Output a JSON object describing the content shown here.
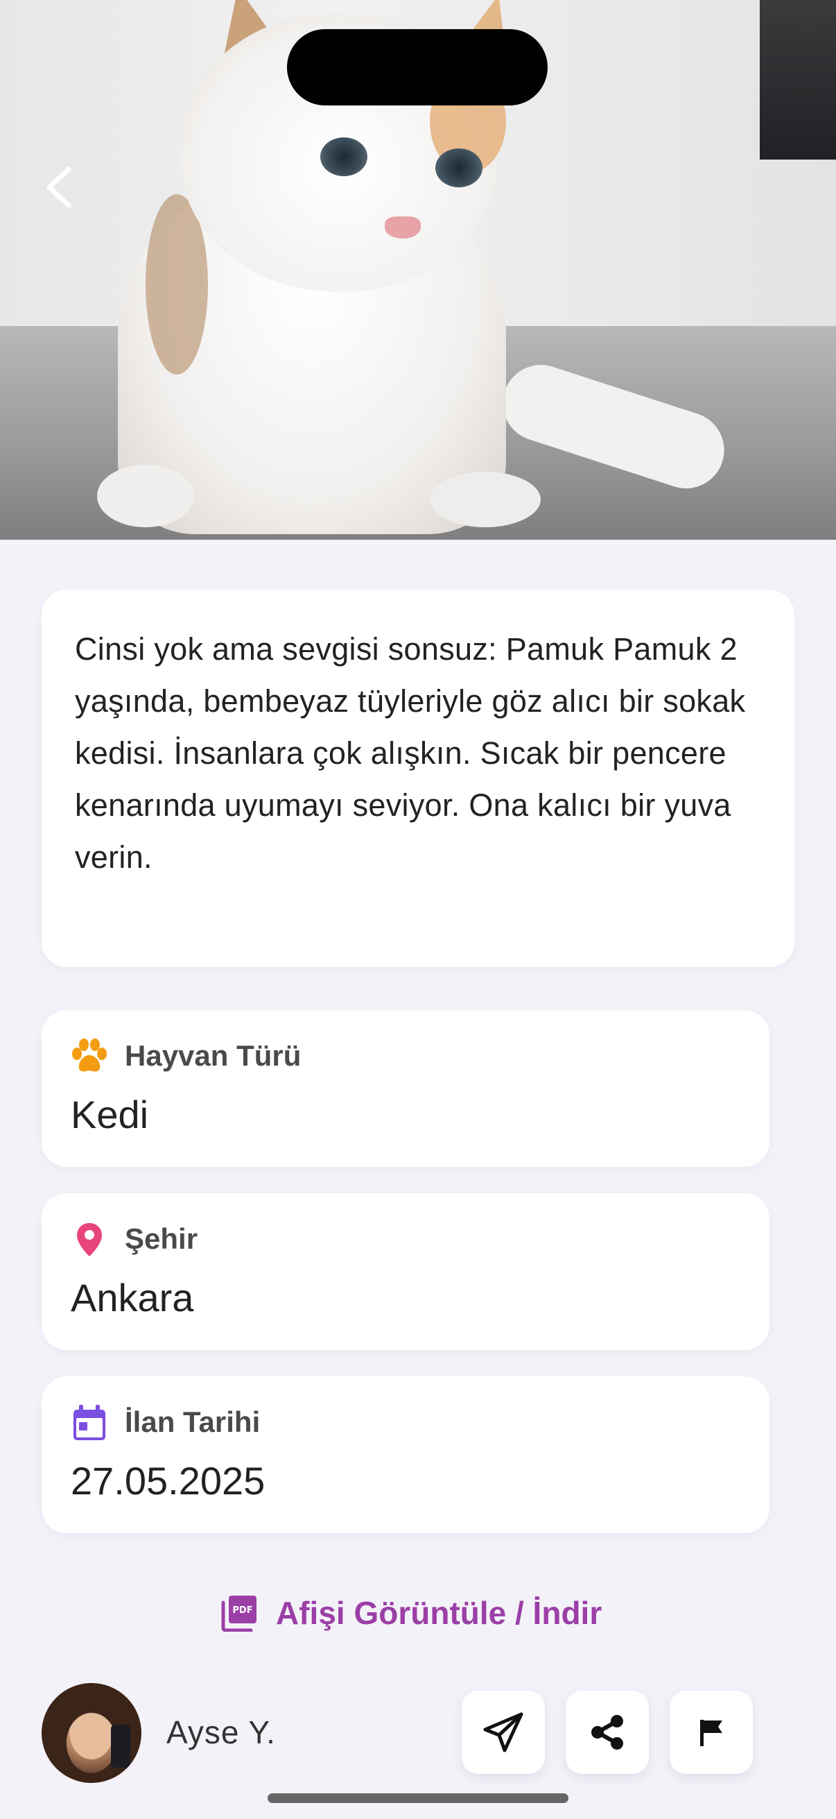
{
  "description": {
    "text": "Cinsi yok ama sevgisi sonsuz: Pamuk Pamuk 2 yaşında, bembeyaz tüyleriyle göz alıcı bir sokak kedisi. İnsanlara çok alışkın. Sıcak bir pencere kenarında uyumayı seviyor. Ona kalıcı bir yuva verin."
  },
  "details": {
    "type": {
      "label": "Hayvan Türü",
      "value": "Kedi",
      "icon": "paw-icon",
      "color": "#f39c12"
    },
    "city": {
      "label": "Şehir",
      "value": "Ankara",
      "icon": "location-pin-icon",
      "color": "#e8457a"
    },
    "date": {
      "label": "İlan Tarihi",
      "value": "27.05.2025",
      "icon": "calendar-icon",
      "color": "#7b4fe0"
    }
  },
  "poster": {
    "label": "Afişi Görüntüle / İndir",
    "icon": "pdf-icon",
    "icon_text": "PDF",
    "color": "#9b3fa6"
  },
  "owner": {
    "name": "Ayse  Y."
  },
  "actions": [
    {
      "name": "send-message",
      "icon": "paper-plane-icon"
    },
    {
      "name": "share",
      "icon": "share-icon"
    },
    {
      "name": "report",
      "icon": "flag-icon"
    }
  ]
}
